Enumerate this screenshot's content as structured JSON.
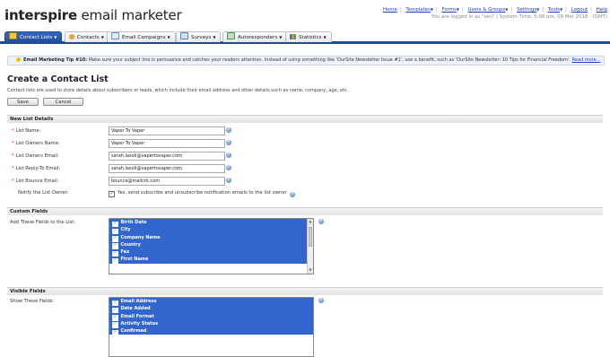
{
  "brand": {
    "bold": "interspire",
    "rest": " email marketer"
  },
  "toplinks": {
    "items": [
      "Home",
      "Templates",
      "Forms",
      "Users & Groups",
      "Settings",
      "Tools",
      "Logout",
      "Help"
    ],
    "login_info": "You are logged in as \"sen\" | System Time: 5:08 pm, 09 Mar 2018 - (GMT)"
  },
  "tabs": [
    {
      "label": "Contact Lists"
    },
    {
      "label": "Contacts"
    },
    {
      "label": "Email Campaigns"
    },
    {
      "label": "Surveys"
    },
    {
      "label": "Autoresponders"
    },
    {
      "label": "Statistics"
    }
  ],
  "tip": {
    "title": "Email Marketing Tip #10:",
    "text": " Make sure your subject line is persuasive and catches your readers attention. Instead of using something like 'OurSite Newsletter Issue #1', use a benefit, such as 'OurSite Newsletter: 10 Tips for Financial Freedom'.",
    "link": "Read more..."
  },
  "page": {
    "title": "Create a Contact List",
    "intro": "Contact lists are used to store details about subscribers or leads, which include their email address and other details such as name, company, age, etc.",
    "save_label": "Save",
    "cancel_label": "Cancel"
  },
  "new_list": {
    "header": "New List Details",
    "fields": [
      {
        "label": "List Name:",
        "value": "Vaper To Vaper"
      },
      {
        "label": "List Owners Name:",
        "value": "Vaper To Vaper"
      },
      {
        "label": "List Owners Email:",
        "value": "sarah.lasoli@vapertovaper.com"
      },
      {
        "label": "List Reply-To Email:",
        "value": "sarah.lasoli@vapertovaper.com"
      },
      {
        "label": "List Bounce Email:",
        "value": "bounce@mailcrk.com"
      }
    ],
    "notify_label": "Notify the List Owner:",
    "notify_text": "Yes, send subscribe and unsubscribe notification emails to the list owner"
  },
  "custom_fields": {
    "header": "Custom Fields",
    "label": "Add These Fields to the List:",
    "items": [
      "Birth Date",
      "City",
      "Company Name",
      "Country",
      "Fax",
      "First Name"
    ]
  },
  "visible_fields": {
    "header": "Visible Fields",
    "label": "Show These Fields:",
    "items": [
      "Email Address",
      "Date Added",
      "Email Format",
      "Activity Status",
      "Confirmed"
    ]
  },
  "colors": {
    "nav": "#1f4a99",
    "selection": "#3366cc",
    "link": "#1a44b8",
    "required": "#dd2222"
  }
}
